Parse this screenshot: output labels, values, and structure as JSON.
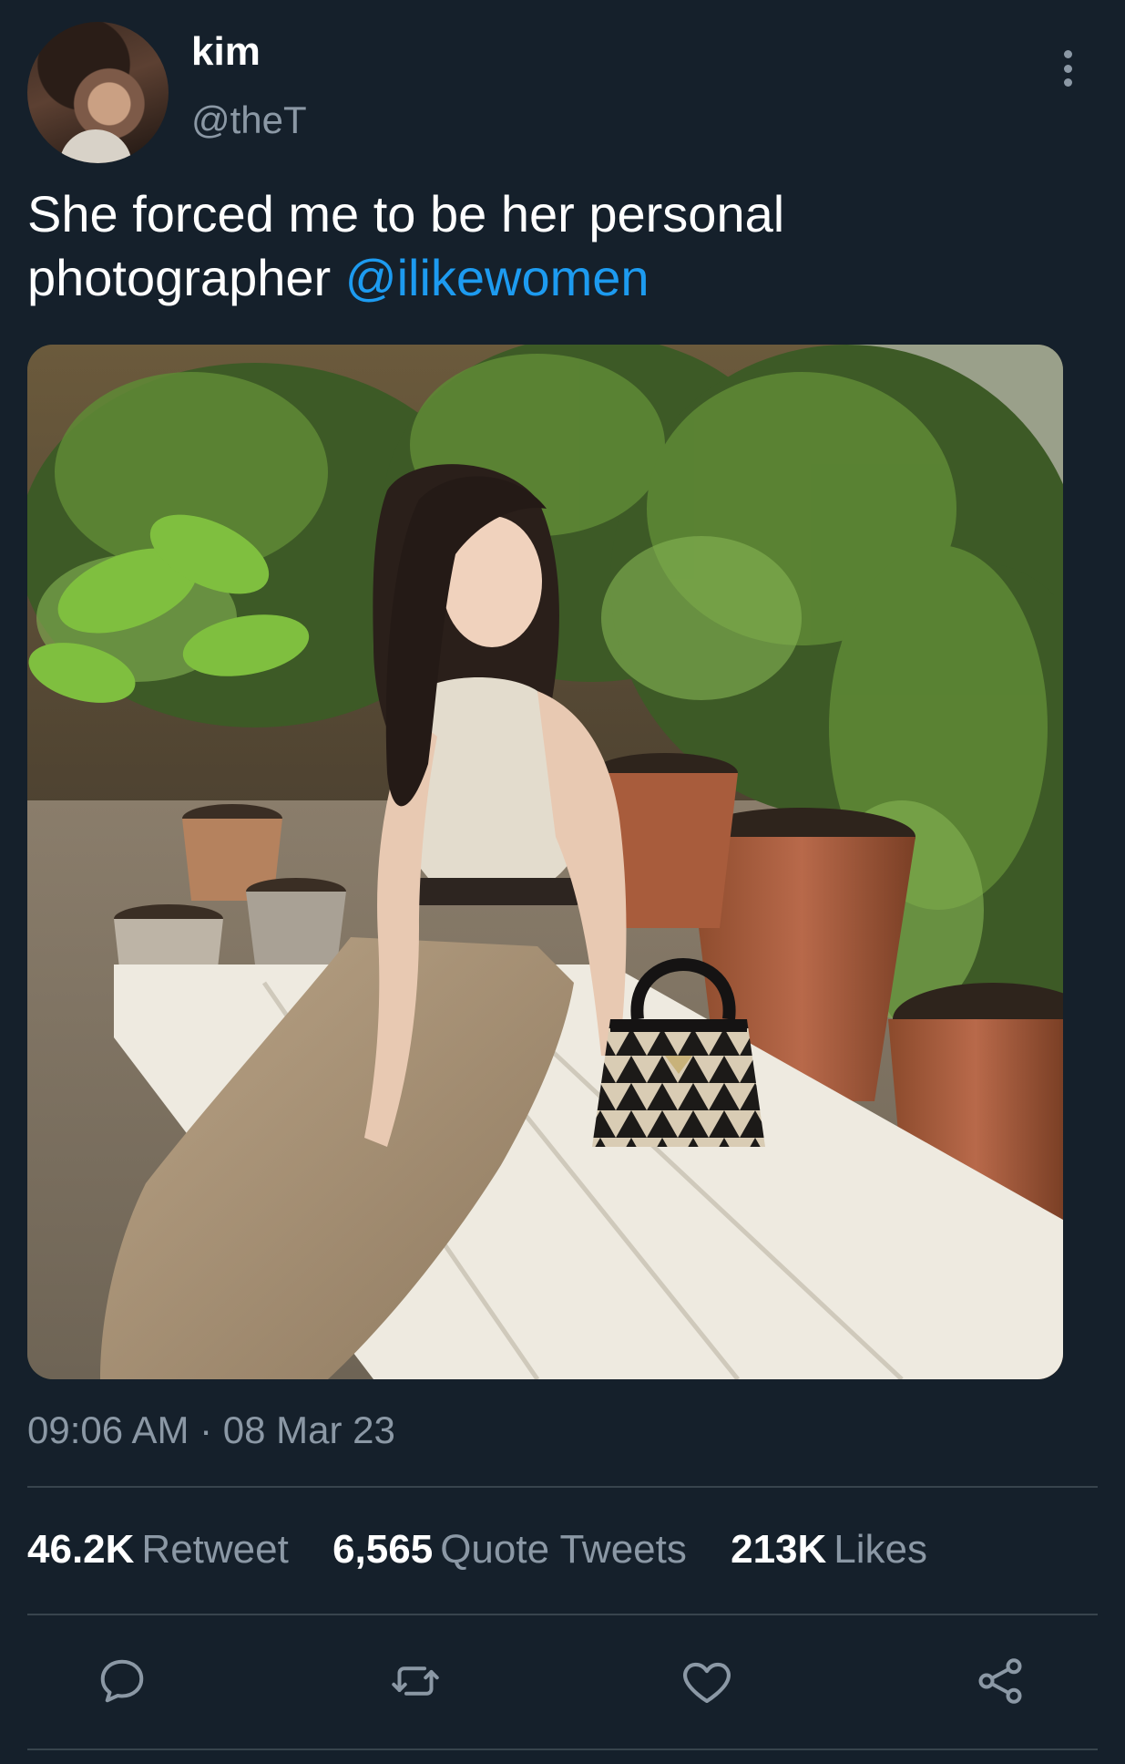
{
  "author": {
    "name": "kim",
    "handle": "@theT"
  },
  "tweet": {
    "text_plain": "She forced me to be her personal photographer ",
    "mention": "@ilikewomen",
    "timestamp": "09:06 AM · 08 Mar 23"
  },
  "stats": {
    "retweets_count": "46.2K",
    "retweets_label": "Retweet",
    "quotes_count": "6,565",
    "quotes_label": "Quote Tweets",
    "likes_count": "213K",
    "likes_label": "Likes"
  },
  "actions": {
    "reply": "reply-icon",
    "retweet": "retweet-icon",
    "like": "heart-icon",
    "share": "share-icon"
  },
  "colors": {
    "background": "#15202b",
    "text": "#ffffff",
    "secondary": "#8b98a5",
    "link": "#1d9bf0",
    "divider": "#38444d"
  }
}
